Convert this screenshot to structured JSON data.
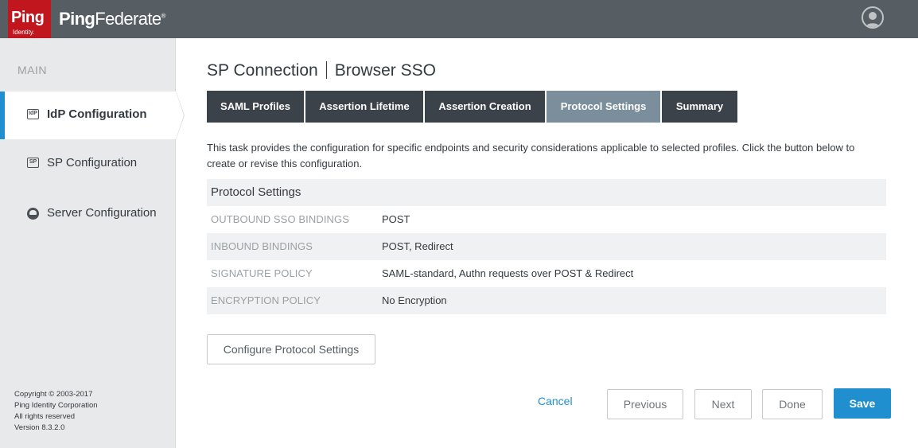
{
  "header": {
    "logo_ping": "Ping",
    "logo_identity": "Identity.",
    "product_part1": "Ping",
    "product_part2": "Federate",
    "product_mark": "®"
  },
  "sidebar": {
    "heading": "MAIN",
    "items": [
      {
        "label": "IdP Configuration",
        "icon": "idp-icon",
        "active": true
      },
      {
        "label": "SP Configuration",
        "icon": "sp-icon",
        "active": false
      },
      {
        "label": "Server Configuration",
        "icon": "server-icon",
        "active": false
      }
    ],
    "copyright": {
      "line1": "Copyright © 2003-2017",
      "line2": "Ping Identity Corporation",
      "line3": "All rights reserved",
      "line4": "Version 8.3.2.0"
    }
  },
  "page": {
    "title_part1": "SP Connection",
    "title_part2": "Browser SSO"
  },
  "tabs": [
    {
      "label": "SAML Profiles",
      "active": false
    },
    {
      "label": "Assertion Lifetime",
      "active": false
    },
    {
      "label": "Assertion Creation",
      "active": false
    },
    {
      "label": "Protocol Settings",
      "active": true
    },
    {
      "label": "Summary",
      "active": false
    }
  ],
  "description": "This task provides the configuration for specific endpoints and security considerations applicable to selected profiles. Click the button below to create or revise this configuration.",
  "protocol_settings": {
    "header": "Protocol Settings",
    "rows": [
      {
        "label": "OUTBOUND SSO BINDINGS",
        "value": "POST"
      },
      {
        "label": "INBOUND BINDINGS",
        "value": "POST, Redirect"
      },
      {
        "label": "SIGNATURE POLICY",
        "value": "SAML-standard, Authn requests over POST & Redirect"
      },
      {
        "label": "ENCRYPTION POLICY",
        "value": "No Encryption"
      }
    ]
  },
  "buttons": {
    "configure": "Configure Protocol Settings",
    "cancel": "Cancel",
    "previous": "Previous",
    "next": "Next",
    "done": "Done",
    "save": "Save"
  },
  "colors": {
    "header_bg": "#575e63",
    "brand_red": "#c1161e",
    "accent_blue": "#1f8fcf",
    "tab_dark": "#3b4249",
    "tab_active": "#7b8e9c"
  }
}
